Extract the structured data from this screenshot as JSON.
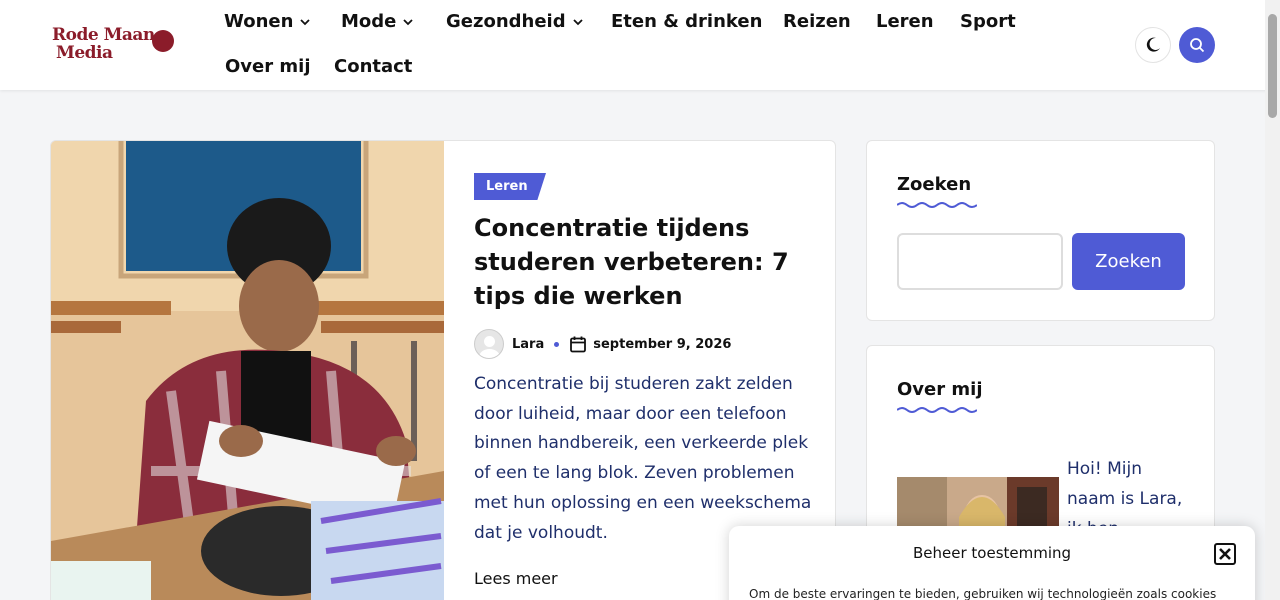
{
  "header": {
    "logo_text_1": "Rode Maan",
    "logo_text_2": "Media",
    "nav": [
      {
        "label": "Wonen",
        "has_dropdown": true
      },
      {
        "label": "Mode",
        "has_dropdown": true
      },
      {
        "label": "Gezondheid",
        "has_dropdown": true
      },
      {
        "label": "Eten & drinken",
        "has_dropdown": false
      },
      {
        "label": "Reizen",
        "has_dropdown": false
      },
      {
        "label": "Leren",
        "has_dropdown": false
      },
      {
        "label": "Sport",
        "has_dropdown": false
      },
      {
        "label": "Over mij",
        "has_dropdown": false
      },
      {
        "label": "Contact",
        "has_dropdown": false
      }
    ],
    "theme_icon": "moon-icon",
    "search_icon": "search-icon"
  },
  "article": {
    "category": "Leren",
    "title": "Concentratie tijdens studeren verbeteren: 7 tips die werken",
    "author": "Lara",
    "date": "september 9, 2026",
    "excerpt": "Concentratie bij studeren zakt zelden door luiheid, maar door een telefoon binnen handbereik, een verkeerde plek of een te lang blok. Zeven problemen met hun oplossing en een weekschema dat je volhoudt.",
    "read_more": "Lees meer"
  },
  "sidebar": {
    "search": {
      "title": "Zoeken",
      "input_value": "",
      "button_label": "Zoeken"
    },
    "about": {
      "title": "Over mij",
      "text": "Hoi! Mijn naam is Lara, ik ben"
    }
  },
  "consent": {
    "title": "Beheer toestemming",
    "text": "Om de beste ervaringen te bieden, gebruiken wij technologieën zoals cookies",
    "close_icon": "close-icon"
  },
  "colors": {
    "accent": "#4f5bd5",
    "brand": "#8b1c2a",
    "excerpt_text": "#1f2f6b"
  }
}
